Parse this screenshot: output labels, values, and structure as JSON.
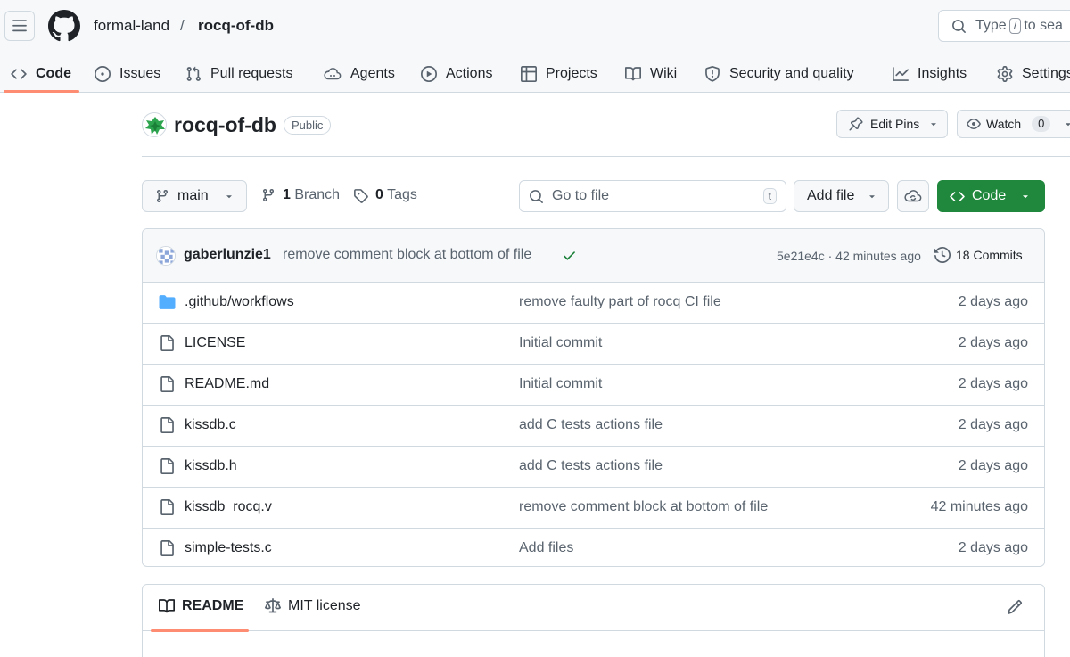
{
  "header": {
    "owner": "formal-land",
    "separator": "/",
    "repo": "rocq-of-db",
    "search_prefix": "Type",
    "search_key": "/",
    "search_suffix": "to sea"
  },
  "nav": {
    "tabs": [
      {
        "label": "Code",
        "icon": "code-icon",
        "active": true
      },
      {
        "label": "Issues",
        "icon": "issue-icon"
      },
      {
        "label": "Pull requests",
        "icon": "pull-request-icon"
      },
      {
        "label": "Agents",
        "icon": "agents-icon"
      },
      {
        "label": "Actions",
        "icon": "play-icon"
      },
      {
        "label": "Projects",
        "icon": "table-icon"
      },
      {
        "label": "Wiki",
        "icon": "book-icon"
      },
      {
        "label": "Security and quality",
        "icon": "shield-icon"
      },
      {
        "label": "Insights",
        "icon": "graph-icon"
      },
      {
        "label": "Settings",
        "icon": "gear-icon"
      }
    ]
  },
  "repo": {
    "name": "rocq-of-db",
    "visibility": "Public",
    "edit_pins_label": "Edit Pins",
    "watch_label": "Watch",
    "watch_count": "0"
  },
  "toolbar": {
    "branch": "main",
    "branch_count": "1",
    "branch_label": "Branch",
    "tag_count": "0",
    "tag_label": "Tags",
    "goto_placeholder": "Go to file",
    "goto_key": "t",
    "add_file_label": "Add file",
    "code_label": "Code"
  },
  "latest_commit": {
    "author": "gaberlunzie1",
    "message": "remove comment block at bottom of file",
    "meta": "5e21e4c · 42 minutes ago",
    "commits_label": "18 Commits"
  },
  "files": [
    {
      "name": ".github/workflows",
      "type": "dir",
      "message": "remove faulty part of rocq CI file",
      "age": "2 days ago"
    },
    {
      "name": "LICENSE",
      "type": "file",
      "message": "Initial commit",
      "age": "2 days ago"
    },
    {
      "name": "README.md",
      "type": "file",
      "message": "Initial commit",
      "age": "2 days ago"
    },
    {
      "name": "kissdb.c",
      "type": "file",
      "message": "add C tests actions file",
      "age": "2 days ago"
    },
    {
      "name": "kissdb.h",
      "type": "file",
      "message": "add C tests actions file",
      "age": "2 days ago"
    },
    {
      "name": "kissdb_rocq.v",
      "type": "file",
      "message": "remove comment block at bottom of file",
      "age": "42 minutes ago"
    },
    {
      "name": "simple-tests.c",
      "type": "file",
      "message": "Add files",
      "age": "2 days ago"
    }
  ],
  "readme": {
    "tab_readme": "README",
    "tab_license": "MIT license"
  },
  "colors": {
    "accent_underline": "#fd8c73",
    "primary_button": "#1f883d",
    "folder": "#54aeff",
    "success": "#1a7f37"
  }
}
